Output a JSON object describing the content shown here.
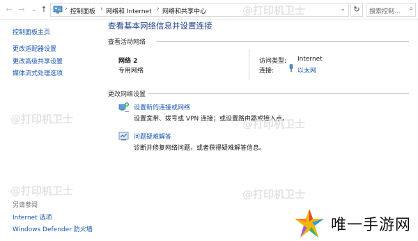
{
  "address": {
    "crumbs": [
      "控制面板",
      "网络和 Internet",
      "网络和共享中心"
    ],
    "search_placeholder": "搜索控制...",
    "refresh_icon": "refresh-icon",
    "search_icon": "search-icon"
  },
  "left": {
    "home": "控制面板主页",
    "links": [
      "更改适配器设置",
      "更改高级共享设置",
      "媒体流式处理选项"
    ],
    "see_also_title": "另请参阅",
    "see_also": [
      "Internet 选项",
      "Windows Defender 防火墙"
    ]
  },
  "main": {
    "title": "查看基本网络信息并设置连接",
    "active_section": "查看活动网络",
    "network": {
      "name": "网络 2",
      "type": "专用网络",
      "access_label": "访问类型:",
      "access_value": "Internet",
      "conn_label": "连接:",
      "conn_value": "以太网"
    },
    "change_section": "更改网络设置",
    "tasks": [
      {
        "link": "设置新的连接或网络",
        "desc": "设置宽带、拨号或 VPN 连接；或设置路由器或接入点。",
        "icon": "new-connection-icon"
      },
      {
        "link": "问题疑难解答",
        "desc": "诊断并修复网络问题，或者获得疑难解答信息。",
        "icon": "troubleshoot-icon"
      }
    ]
  },
  "watermark": "@打印机卫士",
  "logo": {
    "text": "唯一手游网"
  }
}
